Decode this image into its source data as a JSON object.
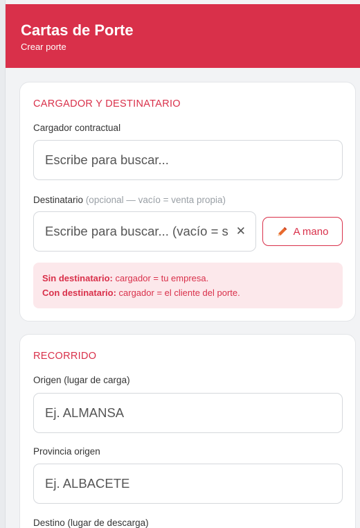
{
  "header": {
    "title": "Cartas de Porte",
    "subtitle": "Crear porte"
  },
  "section1": {
    "title": "CARGADOR Y DESTINATARIO",
    "cargador_label": "Cargador contractual",
    "cargador_placeholder": "Escribe para buscar...",
    "destinatario_label": "Destinatario",
    "destinatario_hint": "(opcional — vacío = venta propia)",
    "destinatario_placeholder": "Escribe para buscar... (vacío = s",
    "clear_glyph": "✕",
    "mano_button": "A mano",
    "info_line1_bold": "Sin destinatario:",
    "info_line1_text": " cargador = tu empresa.",
    "info_line2_bold": "Con destinatario:",
    "info_line2_text": " cargador = el cliente del porte."
  },
  "section2": {
    "title": "RECORRIDO",
    "origen_label": "Origen (lugar de carga)",
    "origen_placeholder": "Ej. ALMANSA",
    "provincia_label": "Provincia origen",
    "provincia_placeholder": "Ej. ALBACETE",
    "destino_label": "Destino (lugar de descarga)"
  },
  "colors": {
    "accent": "#d9304a",
    "info_bg": "#fce8eb",
    "page_bg": "#f2f3f5"
  }
}
